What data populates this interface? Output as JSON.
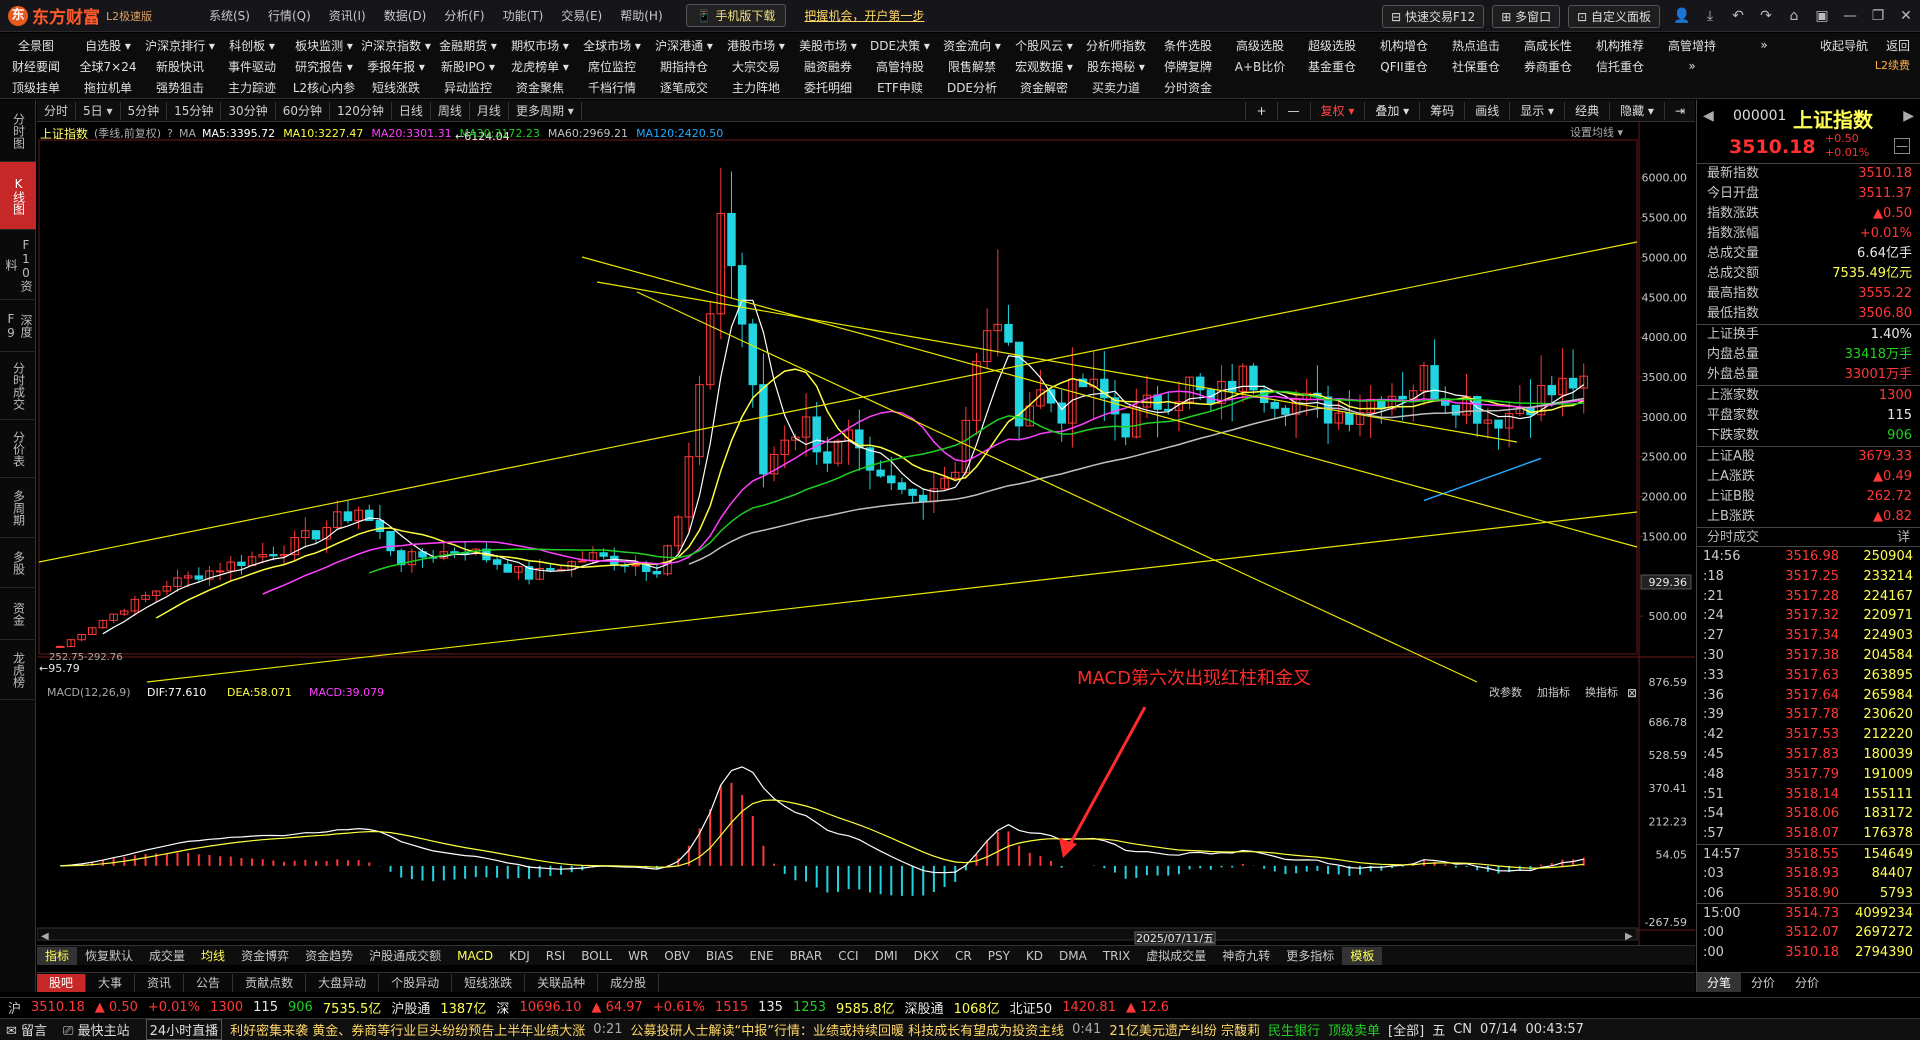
{
  "app": {
    "logo_mark": "东",
    "name": "东方财富",
    "edition": "L2极速版"
  },
  "menu": [
    "系统(S)",
    "行情(Q)",
    "资讯(I)",
    "数据(D)",
    "分析(F)",
    "功能(T)",
    "交易(E)",
    "帮助(H)"
  ],
  "titlebar": {
    "mobile_btn": "手机版下载",
    "promo": "把握机会，开户第一步",
    "quick_trade": "快速交易F12",
    "multi_window": "多窗口",
    "custom_panel": "自定义面板"
  },
  "nav_row1": [
    "全景图",
    "自选股 ▾",
    "沪深京排行 ▾",
    "科创板 ▾",
    "板块监测 ▾",
    "沪深京指数 ▾",
    "金融期货 ▾",
    "期权市场 ▾",
    "全球市场 ▾",
    "沪深港通 ▾",
    "港股市场 ▾",
    "美股市场 ▾",
    "DDE决策 ▾",
    "资金流向 ▾",
    "个股风云 ▾",
    "分析师指数",
    "条件选股",
    "高级选股",
    "超级选股",
    "机构增仓",
    "热点追击",
    "高成长性",
    "机构推荐",
    "高管增持",
    "»"
  ],
  "nav_row2": [
    "财经要闻",
    "全球7×24",
    "新股快讯",
    "事件驱动",
    "研究报告 ▾",
    "季报年报 ▾",
    "新股IPO ▾",
    "龙虎榜单 ▾",
    "席位监控",
    "期指持仓",
    "大宗交易",
    "融资融券",
    "高管持股",
    "限售解禁",
    "宏观数据 ▾",
    "股东揭秘 ▾",
    "停牌复牌",
    "A+B比价",
    "基金重仓",
    "QFII重仓",
    "社保重仓",
    "券商重仓",
    "信托重仓",
    "»"
  ],
  "nav_row3": [
    "顶级挂单",
    "拖拉机单",
    "强势狙击",
    "主力踪迹",
    "L2核心内参",
    "短线涨跌",
    "异动监控",
    "资金聚焦",
    "千档行情",
    "逐笔成交",
    "主力阵地",
    "委托明细",
    "ETF申赎",
    "DDE分析",
    "资金解密",
    "买卖力道",
    "分时资金"
  ],
  "nav_right": {
    "a": "收起导航",
    "b": "返回",
    "l2": "L2续费"
  },
  "left_tabs": [
    "分时图",
    "K线图",
    "F10资料",
    "深度F9",
    "分时成交",
    "分价表",
    "多周期",
    "多股",
    "资金",
    "龙虎榜"
  ],
  "periods": [
    "分时",
    "5日 ▾",
    "5分钟",
    "15分钟",
    "30分钟",
    "60分钟",
    "120分钟",
    "日线",
    "周线",
    "月线",
    "更多周期 ▾"
  ],
  "period_right": [
    "+",
    "—",
    "复权 ▾",
    "叠加 ▾",
    "筹码",
    "画线",
    "显示 ▾",
    "经典",
    "隐藏 ▾"
  ],
  "ma_bar": {
    "name": "上证指数",
    "mode": "(季线,前复权)",
    "ma_label": "MA",
    "ma5": "MA5:3395.72",
    "ma10": "MA10:3227.47",
    "ma20": "MA20:3301.31",
    "ma30": "MA30:3172.23",
    "ma60": "MA60:2969.21",
    "ma120": "MA120:2420.50",
    "set_ma": "设置均线 ▾"
  },
  "colors": {
    "up": "#ff3838",
    "down": "#22d3e0",
    "ma5": "#ffffff",
    "ma10": "#ffff40",
    "ma20": "#ff40ff",
    "ma30": "#20d020",
    "ma60": "#c0c0c0",
    "ma120": "#22aaff",
    "trend": "#e6e600"
  },
  "price_axis": [
    "6000.00",
    "5500.00",
    "5000.00",
    "4500.00",
    "4000.00",
    "3500.00",
    "3000.00",
    "2500.00",
    "2000.00",
    "1500.00",
    "929.36",
    "500.00"
  ],
  "price_annotations": {
    "high": "6124.04",
    "low": "95.79",
    "low2": "252.75-292.76"
  },
  "macd_bar": {
    "label": "MACD(12,26,9)",
    "dif": "DIF:77.610",
    "dea": "DEA:58.071",
    "macd": "MACD:39.079",
    "btn1": "改参数",
    "btn2": "加指标",
    "btn3": "换指标"
  },
  "macd_axis": [
    "876.59",
    "686.78",
    "528.59",
    "370.41",
    "212.23",
    "54.05",
    "-267.59"
  ],
  "annotation": "MACD第六次出现红柱和金叉",
  "date_label": "2025/07/11/五",
  "chart_data": {
    "type": "candlestick",
    "title": "上证指数",
    "period": "季线",
    "ylim": [
      0,
      6500
    ],
    "y_ticks": [
      500,
      1000,
      1500,
      2000,
      2500,
      3000,
      3500,
      4000,
      4500,
      5000,
      5500,
      6000
    ],
    "last_close": 3510.18,
    "quarters": 144,
    "high_point": 6124.04,
    "low_point": 95.79,
    "ma": {
      "ma5": 3395.72,
      "ma10": 3227.47,
      "ma20": 3301.31,
      "ma30": 3172.23,
      "ma60": 2969.21,
      "ma120": 2420.5
    },
    "macd": {
      "dif": 77.61,
      "dea": 58.071,
      "macd": 39.079,
      "ylim": [
        -267.59,
        876.59
      ]
    }
  },
  "quote": {
    "code": "000001",
    "name": "上证指数",
    "price": "3510.18",
    "chg": "+0.50",
    "pct": "+0.01%",
    "rows": [
      {
        "k": "最新指数",
        "v": "3510.18",
        "c": "red"
      },
      {
        "k": "今日开盘",
        "v": "3511.37",
        "c": "red"
      },
      {
        "k": "指数涨跌",
        "v": "▲0.50",
        "c": "red"
      },
      {
        "k": "指数涨幅",
        "v": "+0.01%",
        "c": "red"
      },
      {
        "k": "总成交量",
        "v": "6.64亿手",
        "c": "white"
      },
      {
        "k": "总成交额",
        "v": "7535.49亿元",
        "c": "yellow"
      },
      {
        "k": "最高指数",
        "v": "3555.22",
        "c": "red"
      },
      {
        "k": "最低指数",
        "v": "3506.80",
        "c": "red"
      }
    ],
    "rows2": [
      {
        "k": "上证换手",
        "v": "1.40%",
        "c": "white"
      },
      {
        "k": "内盘总量",
        "v": "33418万手",
        "c": "green"
      },
      {
        "k": "外盘总量",
        "v": "33001万手",
        "c": "red"
      }
    ],
    "rows3": [
      {
        "k": "上涨家数",
        "v": "1300",
        "c": "red"
      },
      {
        "k": "平盘家数",
        "v": "115",
        "c": "white"
      },
      {
        "k": "下跌家数",
        "v": "906",
        "c": "green"
      }
    ],
    "rows4": [
      {
        "k": "上证A股",
        "v": "3679.33",
        "c": "red"
      },
      {
        "k": "上A涨跌",
        "v": "▲0.49",
        "c": "red"
      },
      {
        "k": "上证B股",
        "v": "262.72",
        "c": "red"
      },
      {
        "k": "上B涨跌",
        "v": "▲0.82",
        "c": "red"
      }
    ]
  },
  "ticks_header": {
    "title": "分时成交",
    "more": "详"
  },
  "ticks": [
    [
      "14:56",
      "3516.98",
      "250904"
    ],
    [
      ":18",
      "3517.25",
      "233214"
    ],
    [
      ":21",
      "3517.28",
      "224167"
    ],
    [
      ":24",
      "3517.32",
      "220971"
    ],
    [
      ":27",
      "3517.34",
      "224903"
    ],
    [
      ":30",
      "3517.38",
      "204584"
    ],
    [
      ":33",
      "3517.63",
      "263895"
    ],
    [
      ":36",
      "3517.64",
      "265984"
    ],
    [
      ":39",
      "3517.78",
      "230620"
    ],
    [
      ":42",
      "3517.53",
      "212220"
    ],
    [
      ":45",
      "3517.83",
      "180039"
    ],
    [
      ":48",
      "3517.79",
      "191009"
    ],
    [
      ":51",
      "3518.14",
      "155111"
    ],
    [
      ":54",
      "3518.06",
      "183172"
    ],
    [
      ":57",
      "3518.07",
      "176378"
    ],
    [
      "14:57",
      "3518.55",
      "154649"
    ],
    [
      ":03",
      "3518.93",
      "84407"
    ],
    [
      ":06",
      "3518.90",
      "5793"
    ],
    [
      "15:00",
      "3514.73",
      "4099234"
    ],
    [
      ":00",
      "3512.07",
      "2697272"
    ],
    [
      ":00",
      "3510.18",
      "2794390"
    ]
  ],
  "rp_bottom": [
    "分笔",
    "分价",
    "分价"
  ],
  "ind_tabs": [
    "指标",
    "恢复默认",
    "成交量",
    "均线",
    "资金博弈",
    "资金趋势",
    "沪股通成交额",
    "MACD",
    "KDJ",
    "RSI",
    "BOLL",
    "WR",
    "OBV",
    "BIAS",
    "ENE",
    "BRAR",
    "CCI",
    "DMI",
    "DKX",
    "CR",
    "PSY",
    "KD",
    "DMA",
    "TRIX",
    "虚拟成交量",
    "神奇九转",
    "更多指标",
    "模板"
  ],
  "news_tabs": [
    "股吧",
    "大事",
    "资讯",
    "公告",
    "贡献点数",
    "大盘异动",
    "个股异动",
    "短线涨跌",
    "关联品种",
    "成分股"
  ],
  "status": {
    "sh": "沪",
    "sh_price": "3510.18",
    "sh_chg": "▲ 0.50",
    "sh_pct": "+0.01%",
    "sh_up": "1300",
    "sh_flat": "115",
    "sh_down": "906",
    "sh_amt": "7535.5亿",
    "hgt": "沪股通",
    "hgt_val": "1387亿",
    "sz": "深",
    "sz_price": "10696.10",
    "sz_chg": "▲ 64.97",
    "sz_pct": "+0.61%",
    "sz_up": "1515",
    "sz_flat": "135",
    "sz_down": "1253",
    "sz_amt": "9585.8亿",
    "sgt": "深股通",
    "sgt_val": "1068亿",
    "bz": "北证50",
    "bz_price": "1420.81",
    "extra": "▲ 12.6"
  },
  "ticker": {
    "msg": "留言",
    "home": "最快主站",
    "live": "24小时直播",
    "news1": "利好密集来袭 黄金、券商等行业巨头纷纷预告上半年业绩大涨",
    "t1": "0:21",
    "news2": "公募投研人士解读“中报”行情：业绩或持续回暖 科技成长有望成为投资主线",
    "t2": "0:41",
    "news3": "21亿美元遗产纠纷 宗馥莉",
    "stock": "民生银行",
    "stock_tag": "顶级卖单",
    "all": "[全部]",
    "ime": "五",
    "net": "CN",
    "date": "07/14",
    "time": "00:43:57"
  }
}
